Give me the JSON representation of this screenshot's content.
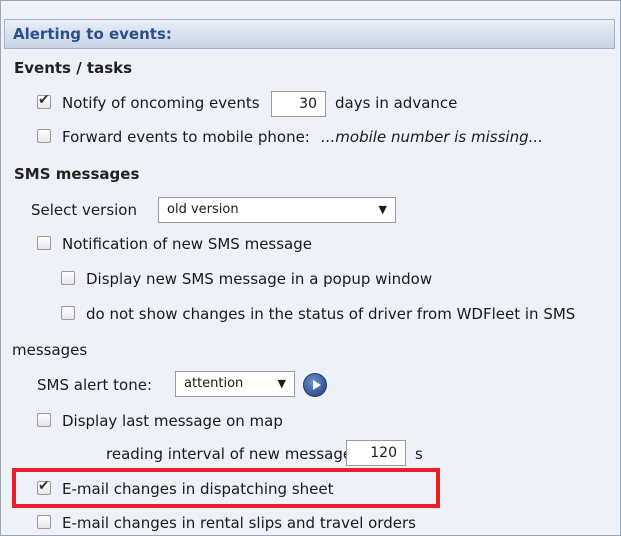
{
  "header": {
    "title": "Alerting to events:"
  },
  "events": {
    "section_title": "Events / tasks",
    "notify_label": "Notify of oncoming events",
    "notify_days_value": "30",
    "notify_suffix": "days in advance",
    "forward_label": "Forward events to mobile phone:",
    "forward_missing": "...mobile number is missing..."
  },
  "sms": {
    "section_title": "SMS messages",
    "select_version_label": "Select version",
    "version_value": "old version",
    "notification_label": "Notification of new SMS message",
    "popup_label": "Display new SMS message in a popup window",
    "no_status_label_line1": "do not show changes in the status of driver from WDFleet in SMS",
    "no_status_label_line2": "messages",
    "alert_tone_label": "SMS alert tone:",
    "alert_tone_value": "attention",
    "display_last_label": "Display last message on map",
    "interval_label": "reading interval of new messages",
    "interval_value": "120",
    "interval_unit": "s"
  },
  "email": {
    "dispatching_label": "E-mail changes in dispatching sheet",
    "rental_label": "E-mail changes in rental slips and travel orders"
  },
  "checked": {
    "notify": true,
    "forward": false,
    "notification": false,
    "popup": false,
    "no_status": false,
    "display_last": false,
    "dispatching": true,
    "rental": false
  }
}
